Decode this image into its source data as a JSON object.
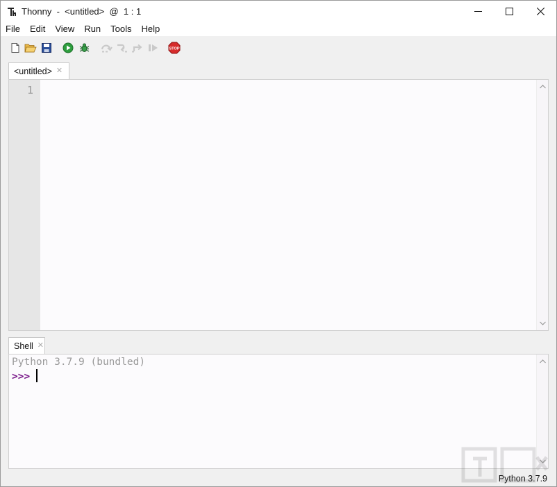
{
  "window": {
    "title": "Thonny  -  <untitled>  @  1 : 1"
  },
  "menu": {
    "items": [
      "File",
      "Edit",
      "View",
      "Run",
      "Tools",
      "Help"
    ]
  },
  "toolbar": {
    "buttons": [
      {
        "name": "new-file",
        "icon": "new-file-icon"
      },
      {
        "name": "open-file",
        "icon": "open-folder-icon"
      },
      {
        "name": "save-file",
        "icon": "save-icon"
      },
      {
        "name": "run",
        "icon": "run-icon"
      },
      {
        "name": "debug",
        "icon": "bug-icon"
      },
      {
        "name": "step-over",
        "icon": "step-over-icon",
        "enabled": false
      },
      {
        "name": "step-into",
        "icon": "step-into-icon",
        "enabled": false
      },
      {
        "name": "step-out",
        "icon": "step-out-icon",
        "enabled": false
      },
      {
        "name": "resume",
        "icon": "resume-icon",
        "enabled": false
      },
      {
        "name": "stop",
        "icon": "stop-icon",
        "label": "STOP"
      }
    ]
  },
  "editor": {
    "tab_label": "<untitled>",
    "line_numbers": [
      "1"
    ]
  },
  "shell": {
    "tab_label": "Shell",
    "banner": "Python 3.7.9 (bundled)",
    "prompt": ">>>"
  },
  "status": {
    "interpreter": "Python 3.7.9"
  },
  "colors": {
    "run_green": "#2e9e3e",
    "stop_red": "#d62b2b",
    "prompt_purple": "#7a1a8a",
    "gutter": "#e6e6e6"
  }
}
